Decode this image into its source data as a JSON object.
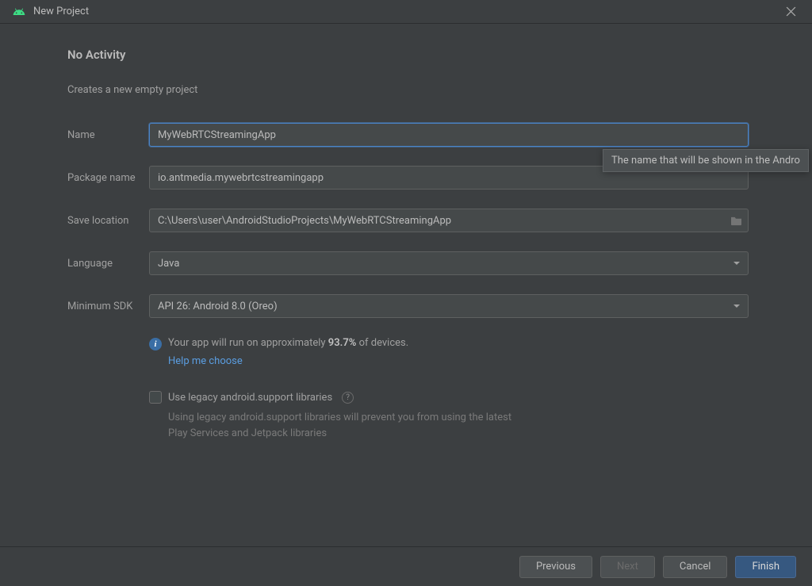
{
  "titlebar": {
    "title": "New Project"
  },
  "header": {
    "heading": "No Activity",
    "subheading": "Creates a new empty project"
  },
  "form": {
    "name": {
      "label": "Name",
      "value": "MyWebRTCStreamingApp"
    },
    "package": {
      "label": "Package name",
      "value": "io.antmedia.mywebrtcstreamingapp"
    },
    "location": {
      "label": "Save location",
      "value": "C:\\Users\\user\\AndroidStudioProjects\\MyWebRTCStreamingApp"
    },
    "language": {
      "label": "Language",
      "value": "Java"
    },
    "minsdk": {
      "label": "Minimum SDK",
      "value": "API 26: Android 8.0 (Oreo)"
    }
  },
  "info": {
    "text_prefix": "Your app will run on approximately ",
    "percent": "93.7%",
    "text_suffix": " of devices.",
    "help_link": "Help me choose"
  },
  "legacy": {
    "label": "Use legacy android.support libraries",
    "hint": "Using legacy android.support libraries will prevent you from using the latest Play Services and Jetpack libraries"
  },
  "tooltip": {
    "text": "The name that will be shown in the Andro"
  },
  "buttons": {
    "previous": "Previous",
    "next": "Next",
    "cancel": "Cancel",
    "finish": "Finish"
  }
}
